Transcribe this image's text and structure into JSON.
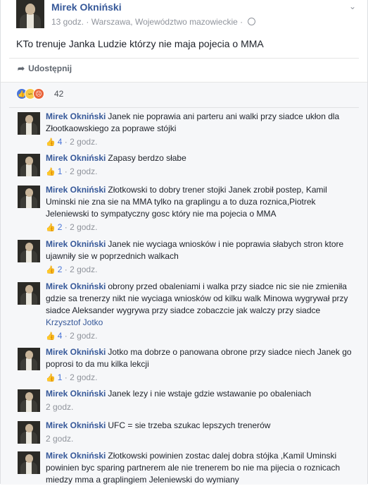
{
  "post": {
    "author": "Mirek Okniński",
    "time": "13 godz.",
    "location": "Warszawa, Województwo mazowieckie",
    "dot": "·",
    "text": "KTo trenuje Janka Ludzie którzy nie maja pojecia o MMA",
    "share_label": "Udostępnij"
  },
  "reactions": {
    "count": "42",
    "types": [
      "like",
      "haha",
      "angry"
    ]
  },
  "comments": [
    {
      "author": "Mirek Okniński",
      "text": "Janek nie poprawia ani parteru ani walki przy siadce ukłon dla Złootkaowskiego za poprawe stójki",
      "likes": "4",
      "time": "2 godz."
    },
    {
      "author": "Mirek Okniński",
      "text": "Zapasy berdzo słabe",
      "likes": "1",
      "time": "2 godz."
    },
    {
      "author": "Mirek Okniński",
      "text": "Złotkowski to dobry trener stojki Janek zrobił postep, Kamil Uminski nie zna sie na MMA tylko na graplingu a to duza roznica,Piotrek Jeleniewski to sympatyczny gosc który nie ma pojecia o MMA",
      "likes": "2",
      "time": "2 godz."
    },
    {
      "author": "Mirek Okniński",
      "text": "Janek nie wyciaga wniosków i nie poprawia słabych stron ktore ujawniły sie w poprzednich walkach",
      "likes": "2",
      "time": "2 godz."
    },
    {
      "author": "Mirek Okniński",
      "text": "obrony przed obaleniami i walka przy siadce nic sie nie zmieniła gdzie sa trenerzy nikt nie wyciaga wniosków od kilku walk Minowa wygrywał przy siadce Aleksander wygrywa przy siadce zobaczcie jak walczy przy siadce",
      "tag": "Krzysztof Jotko",
      "likes": "4",
      "time": "2 godz."
    },
    {
      "author": "Mirek Okniński",
      "text": "Jotko ma dobrze o panowana obrone przy siadce niech Janek go poprosi to da mu kilka lekcji",
      "likes": "1",
      "time": "2 godz."
    },
    {
      "author": "Mirek Okniński",
      "text": "Janek lezy i nie wstaje gdzie wstawanie po obaleniach",
      "likes": "",
      "time": "2 godz."
    },
    {
      "author": "Mirek Okniński",
      "text": "UFC = sie trzeba szukac lepszych trenerów",
      "likes": "",
      "time": "2 godz."
    },
    {
      "author": "Mirek Okniński",
      "text": "Złotkowski powinien zostac dalej dobra stójka ,Kamil Uminski powinien byc sparing partnerem ale nie trenerem bo nie ma pijecia o roznicach miedzy mma a graplingiem Jeleniewski do wymiany",
      "likes": "",
      "time": ""
    }
  ]
}
